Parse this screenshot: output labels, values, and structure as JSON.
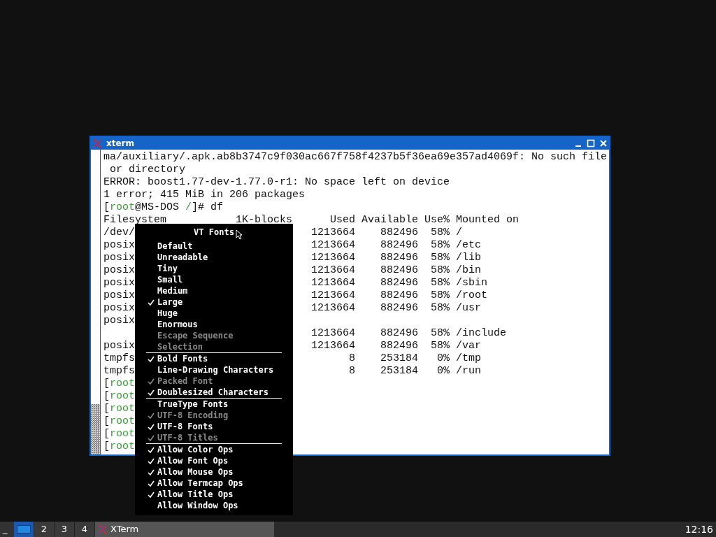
{
  "window": {
    "title": "xterm"
  },
  "terminal": {
    "rows": [
      {
        "kind": "text",
        "segments": [
          {
            "text": "ma/auxiliary/.apk.ab8b3747c9f030ac667f758f4237b5f36ea69e357ad4069f: No such file",
            "kind": "plain"
          }
        ]
      },
      {
        "kind": "text",
        "segments": [
          {
            "text": " or directory",
            "kind": "plain"
          }
        ]
      },
      {
        "kind": "text",
        "segments": [
          {
            "text": "ERROR: boost1.77-dev-1.77.0-r1: No space left on device",
            "kind": "plain"
          }
        ]
      },
      {
        "kind": "text",
        "segments": [
          {
            "text": "1 error; 415 MiB in 206 packages",
            "kind": "plain"
          }
        ]
      },
      {
        "kind": "text",
        "segments": [
          {
            "text": "[",
            "kind": "plain"
          },
          {
            "text": "root",
            "kind": "highlight"
          },
          {
            "text": "@MS-DOS ",
            "kind": "plain"
          },
          {
            "text": "/",
            "kind": "highlight"
          },
          {
            "text": "]# df",
            "kind": "plain"
          }
        ]
      },
      {
        "kind": "text",
        "segments": [
          {
            "text": "Filesystem           1K-blocks      Used Available Use% Mounted on",
            "kind": "plain"
          }
        ]
      },
      {
        "kind": "df",
        "filesystem": "/dev/",
        "used": "1213664",
        "available": "882496",
        "use": "58%",
        "mounted": "/"
      },
      {
        "kind": "df",
        "filesystem": "posix",
        "used": "1213664",
        "available": "882496",
        "use": "58%",
        "mounted": "/etc"
      },
      {
        "kind": "df",
        "filesystem": "posix",
        "used": "1213664",
        "available": "882496",
        "use": "58%",
        "mounted": "/lib"
      },
      {
        "kind": "df",
        "filesystem": "posix",
        "used": "1213664",
        "available": "882496",
        "use": "58%",
        "mounted": "/bin"
      },
      {
        "kind": "df",
        "filesystem": "posix",
        "used": "1213664",
        "available": "882496",
        "use": "58%",
        "mounted": "/sbin"
      },
      {
        "kind": "df",
        "filesystem": "posix",
        "used": "1213664",
        "available": "882496",
        "use": "58%",
        "mounted": "/root"
      },
      {
        "kind": "df",
        "filesystem": "posix",
        "used": "1213664",
        "available": "882496",
        "use": "58%",
        "mounted": "/usr"
      },
      {
        "kind": "df",
        "filesystem": "posix"
      },
      {
        "kind": "df",
        "used": "1213664",
        "available": "882496",
        "use": "58%",
        "mounted": "/include"
      },
      {
        "kind": "df",
        "filesystem": "posix",
        "used": "1213664",
        "available": "882496",
        "use": "58%",
        "mounted": "/var"
      },
      {
        "kind": "df",
        "filesystem": "tmpfs",
        "used": "8",
        "available": "253184",
        "use": "0%",
        "mounted": "/tmp"
      },
      {
        "kind": "df",
        "filesystem": "tmpfs",
        "used": "8",
        "available": "253184",
        "use": "0%",
        "mounted": "/run"
      },
      {
        "kind": "text",
        "segments": [
          {
            "text": "[",
            "kind": "plain"
          },
          {
            "text": "root",
            "kind": "highlight"
          }
        ]
      },
      {
        "kind": "text",
        "segments": [
          {
            "text": "[",
            "kind": "plain"
          },
          {
            "text": "root",
            "kind": "highlight"
          }
        ]
      },
      {
        "kind": "text",
        "segments": [
          {
            "text": "[",
            "kind": "plain"
          },
          {
            "text": "root",
            "kind": "highlight"
          }
        ]
      },
      {
        "kind": "text",
        "segments": [
          {
            "text": "[",
            "kind": "plain"
          },
          {
            "text": "root",
            "kind": "highlight"
          }
        ]
      },
      {
        "kind": "text",
        "segments": [
          {
            "text": "[",
            "kind": "plain"
          },
          {
            "text": "root",
            "kind": "highlight"
          }
        ]
      },
      {
        "kind": "text",
        "segments": [
          {
            "text": "[",
            "kind": "plain"
          },
          {
            "text": "root",
            "kind": "highlight"
          }
        ]
      }
    ]
  },
  "menu": {
    "title": "VT Fonts",
    "items": [
      {
        "kind": "item",
        "label": "Default",
        "checked": false,
        "disabled": false
      },
      {
        "kind": "item",
        "label": "Unreadable",
        "checked": false,
        "disabled": false
      },
      {
        "kind": "item",
        "label": "Tiny",
        "checked": false,
        "disabled": false
      },
      {
        "kind": "item",
        "label": "Small",
        "checked": false,
        "disabled": false
      },
      {
        "kind": "item",
        "label": "Medium",
        "checked": false,
        "disabled": false
      },
      {
        "kind": "item",
        "label": "Large",
        "checked": true,
        "disabled": false
      },
      {
        "kind": "item",
        "label": "Huge",
        "checked": false,
        "disabled": false
      },
      {
        "kind": "item",
        "label": "Enormous",
        "checked": false,
        "disabled": false
      },
      {
        "kind": "item",
        "label": "Escape Sequence",
        "checked": false,
        "disabled": true
      },
      {
        "kind": "item",
        "label": "Selection",
        "checked": false,
        "disabled": true
      },
      {
        "kind": "separator"
      },
      {
        "kind": "item",
        "label": "Bold Fonts",
        "checked": true,
        "disabled": false
      },
      {
        "kind": "item",
        "label": "Line-Drawing Characters",
        "checked": false,
        "disabled": false
      },
      {
        "kind": "item",
        "label": "Packed Font",
        "checked": true,
        "disabled": true
      },
      {
        "kind": "item",
        "label": "Doublesized Characters",
        "checked": true,
        "disabled": false
      },
      {
        "kind": "separator"
      },
      {
        "kind": "item",
        "label": "TrueType Fonts",
        "checked": false,
        "disabled": false
      },
      {
        "kind": "item",
        "label": "UTF-8 Encoding",
        "checked": true,
        "disabled": true
      },
      {
        "kind": "item",
        "label": "UTF-8 Fonts",
        "checked": true,
        "disabled": false
      },
      {
        "kind": "item",
        "label": "UTF-8 Titles",
        "checked": true,
        "disabled": true
      },
      {
        "kind": "separator"
      },
      {
        "kind": "item",
        "label": "Allow Color Ops",
        "checked": true,
        "disabled": false
      },
      {
        "kind": "item",
        "label": "Allow Font Ops",
        "checked": true,
        "disabled": false
      },
      {
        "kind": "item",
        "label": "Allow Mouse Ops",
        "checked": true,
        "disabled": false
      },
      {
        "kind": "item",
        "label": "Allow Termcap Ops",
        "checked": true,
        "disabled": false
      },
      {
        "kind": "item",
        "label": "Allow Title Ops",
        "checked": true,
        "disabled": false
      },
      {
        "kind": "item",
        "label": "Allow Window Ops",
        "checked": false,
        "disabled": false
      }
    ]
  },
  "taskbar": {
    "show_desktop": "_",
    "desktops": [
      {
        "selected": true
      },
      {
        "label": "2",
        "selected": false
      },
      {
        "label": "3",
        "selected": false
      },
      {
        "label": "4",
        "selected": false
      }
    ],
    "tasks": [
      {
        "label": "XTerm",
        "selected": true
      }
    ],
    "clock": "12:16"
  }
}
